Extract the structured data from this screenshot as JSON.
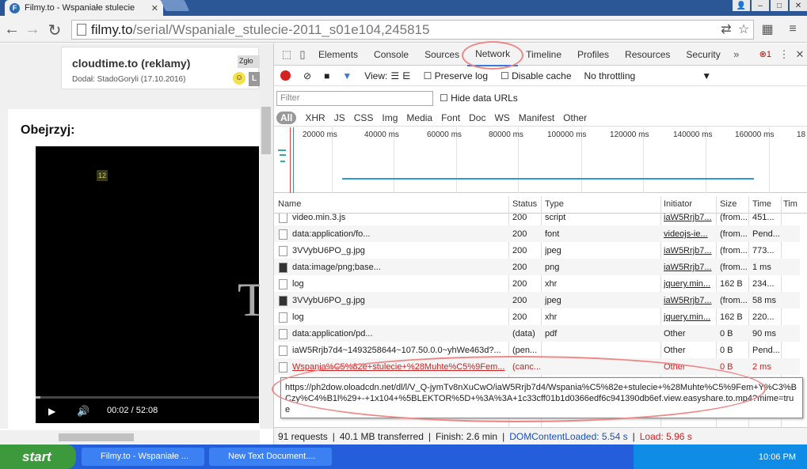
{
  "browser": {
    "tab_title": "Filmy.to - Wspaniałe stulecie",
    "url_host": "filmy.to",
    "url_path": "/serial/Wspaniale_stulecie-2011_s01e104,245815"
  },
  "page": {
    "comment_name": "cloudtime.to (reklamy)",
    "comment_meta": "Dodał: StadoGoryli (17.10.2016)",
    "report_label": "Zgło",
    "watch_label": "Obejrzyj:",
    "age_rating": "12",
    "video_title_fragment": "T",
    "time_current": "00:02",
    "time_sep": "/",
    "time_total": "52:08",
    "progress": 0.02
  },
  "devtools": {
    "tabs": [
      "Elements",
      "Console",
      "Sources",
      "Network",
      "Timeline",
      "Profiles",
      "Resources",
      "Security"
    ],
    "active_tab": "Network",
    "error_count": "1",
    "toolbar": {
      "view_label": "View:",
      "preserve_log": "Preserve log",
      "disable_cache": "Disable cache",
      "throttling": "No throttling"
    },
    "filter_placeholder": "Filter",
    "hide_data_urls": "Hide data URLs",
    "types": [
      "All",
      "XHR",
      "JS",
      "CSS",
      "Img",
      "Media",
      "Font",
      "Doc",
      "WS",
      "Manifest",
      "Other"
    ],
    "timeline_ticks": [
      "20000 ms",
      "40000 ms",
      "60000 ms",
      "80000 ms",
      "100000 ms",
      "120000 ms",
      "140000 ms",
      "160000 ms",
      "18"
    ],
    "columns": [
      "Name",
      "Status",
      "Type",
      "Initiator",
      "Size",
      "Time",
      "Tim"
    ],
    "rows": [
      {
        "name": "video.min.3.js",
        "status": "200",
        "type": "script",
        "initiator": "iaW5Rrjb7...",
        "size": "(from...",
        "time": "451..."
      },
      {
        "name": "data:application/fo...",
        "status": "200",
        "type": "font",
        "initiator": "videojs-ie...",
        "size": "(from...",
        "time": "Pend..."
      },
      {
        "name": "3VVybU6PO_g.jpg",
        "status": "200",
        "type": "jpeg",
        "initiator": "iaW5Rrjb7...",
        "size": "(from...",
        "time": "773..."
      },
      {
        "name": "data:image/png;base...",
        "status": "200",
        "type": "png",
        "initiator": "iaW5Rrjb7...",
        "size": "(from...",
        "time": "1 ms"
      },
      {
        "name": "log",
        "status": "200",
        "type": "xhr",
        "initiator": "jquery.min...",
        "size": "162 B",
        "time": "234..."
      },
      {
        "name": "3VVybU6PO_g.jpg",
        "status": "200",
        "type": "jpeg",
        "initiator": "iaW5Rrjb7...",
        "size": "(from...",
        "time": "58 ms"
      },
      {
        "name": "log",
        "status": "200",
        "type": "xhr",
        "initiator": "jquery.min...",
        "size": "162 B",
        "time": "220..."
      },
      {
        "name": "data:application/pd...",
        "status": "(data)",
        "type": "pdf",
        "initiator": "Other",
        "size": "0 B",
        "time": "90 ms"
      },
      {
        "name": "iaW5Rrjb7d4~1493258644~107.50.0.0~yhWe463d?...",
        "status": "(pen...",
        "type": "",
        "initiator": "Other",
        "size": "0 B",
        "time": "Pend..."
      },
      {
        "name": "Wspania%C5%82e+stulecie+%28Muhte%C5%9Fem...",
        "status": "(canc...",
        "type": "",
        "initiator": "Other",
        "size": "0 B",
        "time": "2 ms"
      }
    ],
    "tooltip": "https://ph2dow.oloadcdn.net/dl/l/V_Q-jymTv8nXuCwO/iaW5Rrjb7d4/Wspania%C5%82e+stulecie+%28Muhte%C5%9Fem+Y%C3%BCzy%C4%B1l%29+-+1x104+%5BLEKTOR%5D+%3A%3A+1c33cff01b1d0366edf6c941390db6ef.view.easyshare.to.mp4?mime=true",
    "status_bar": {
      "requests": "91 requests",
      "transferred": "40.1 MB transferred",
      "finish": "Finish: 2.6 min",
      "dcl": "DOMContentLoaded: 5.54 s",
      "load": "Load: 5.96 s"
    }
  },
  "taskbar": {
    "start": "start",
    "items": [
      "Filmy.to - Wspaniałe ...",
      "New Text Document...."
    ],
    "clock": "10:06 PM"
  }
}
